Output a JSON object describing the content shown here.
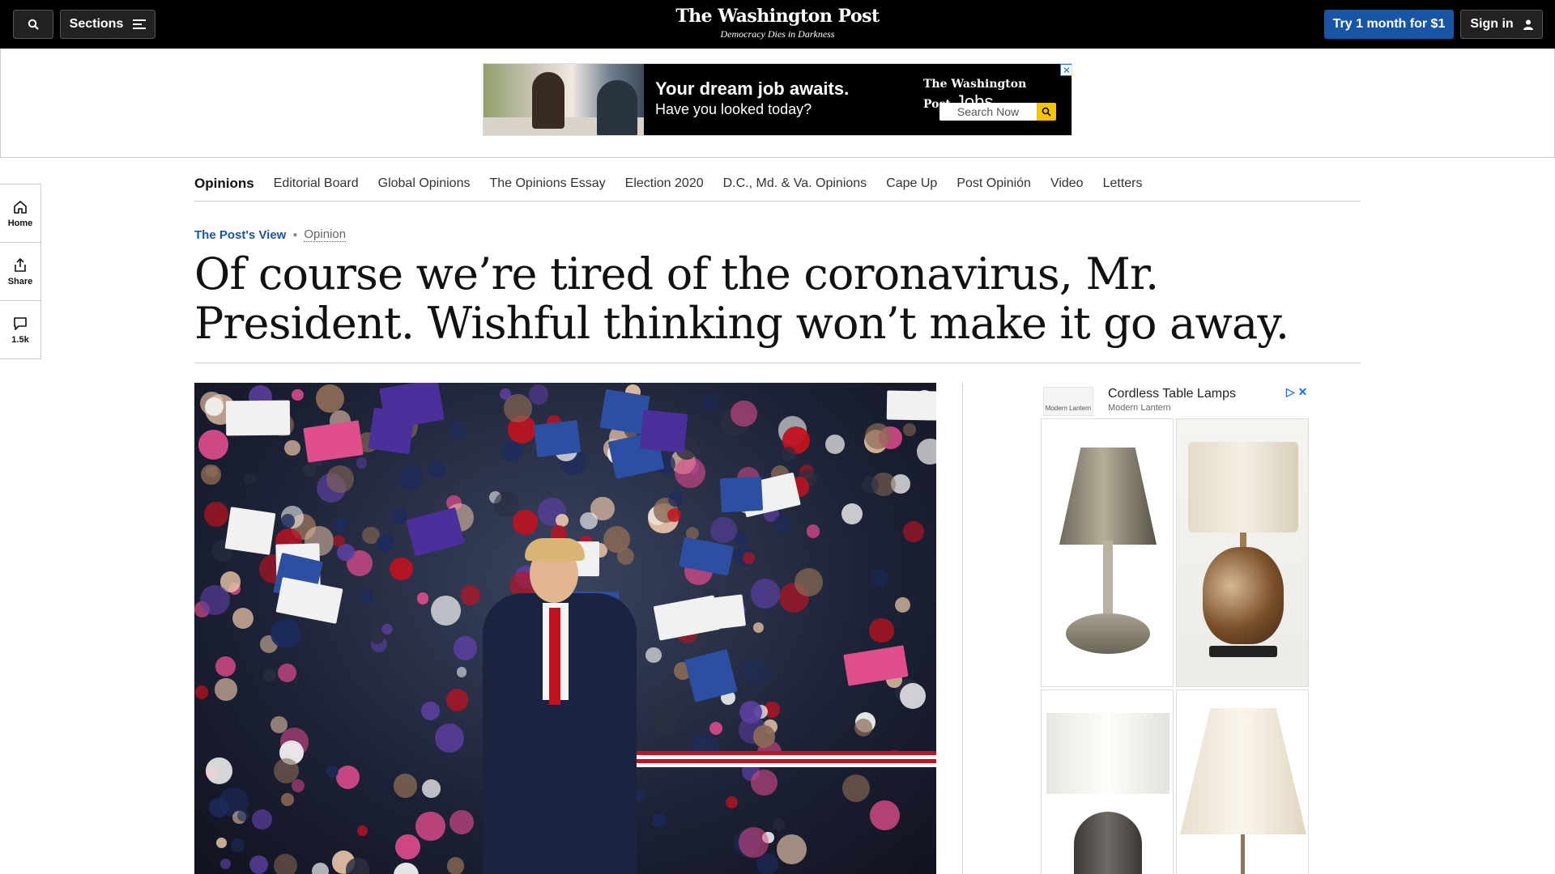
{
  "topbar": {
    "sections_label": "Sections",
    "logo": "The Washington Post",
    "tagline": "Democracy Dies in Darkness",
    "subscribe_label": "Try 1 month for $1",
    "signin_label": "Sign in"
  },
  "top_ad": {
    "headline": "Your dream job awaits.",
    "subline": "Have you looked today?",
    "brand": "The Washington Post",
    "brand_suffix": "Jobs",
    "search_label": "Search Now",
    "close": "✕"
  },
  "rail": {
    "home_label": "Home",
    "share_label": "Share",
    "comments_count": "1.5k"
  },
  "subnav": {
    "items": [
      "Opinions",
      "Editorial Board",
      "Global Opinions",
      "The Opinions Essay",
      "Election 2020",
      "D.C., Md. & Va. Opinions",
      "Cape Up",
      "Post Opinión",
      "Video",
      "Letters"
    ]
  },
  "article": {
    "kicker": "The Post's View",
    "section": "Opinion",
    "headline": "Of course we’re tired of the coronavirus, Mr. President. Wishful thinking won’t make it go away."
  },
  "side_ad": {
    "brand_logo_text": "Modern Lantern",
    "title": "Cordless Table Lamps",
    "advertiser": "Modern Lantern",
    "choice_icons": "▷ ✕"
  },
  "colors": {
    "topbar_bg": "#000000",
    "accent_blue": "#1955a5",
    "jobs_search_button": "#f5c400"
  }
}
